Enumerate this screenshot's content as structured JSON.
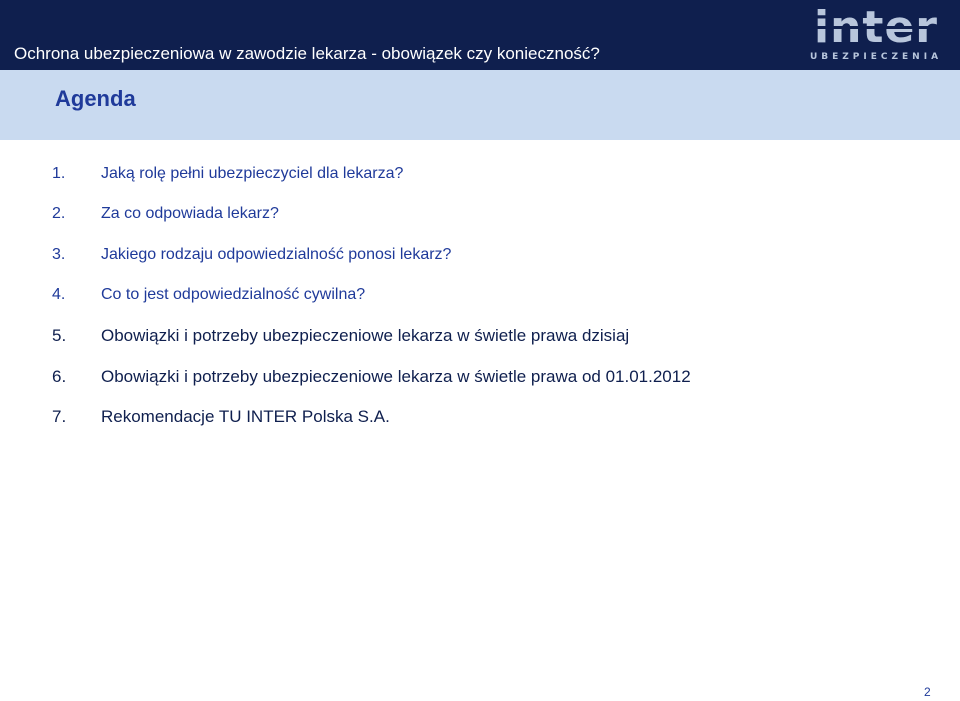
{
  "header": {
    "title": "Ochrona ubezpieczeniowa w zawodzie lekarza - obowiązek czy konieczność?",
    "logo_main": "inter",
    "logo_sub": "UBEZPIECZENIA"
  },
  "agenda": {
    "title": "Agenda",
    "items": [
      {
        "number": "1.",
        "text": "Jaką rolę pełni ubezpieczyciel dla lekarza?"
      },
      {
        "number": "2.",
        "text": "Za co odpowiada lekarz?"
      },
      {
        "number": "3.",
        "text": "Jakiego rodzaju odpowiedzialność ponosi lekarz?"
      },
      {
        "number": "4.",
        "text": "Co to jest odpowiedzialność cywilna?"
      },
      {
        "number": "5.",
        "text": "Obowiązki i potrzeby ubezpieczeniowe lekarza w świetle prawa dzisiaj"
      },
      {
        "number": "6.",
        "text": "Obowiązki i potrzeby ubezpieczeniowe lekarza w świetle prawa od 01.01.2012"
      },
      {
        "number": "7.",
        "text": "Rekomendacje TU INTER Polska S.A."
      }
    ]
  },
  "page_number": "2",
  "colors": {
    "header_bg": "#0f1f4e",
    "agenda_band": "#c9daf0",
    "accent_blue": "#1f3a9a",
    "items_1_4": "#1f3a9a",
    "items_5_7": "#0f1f4e"
  }
}
